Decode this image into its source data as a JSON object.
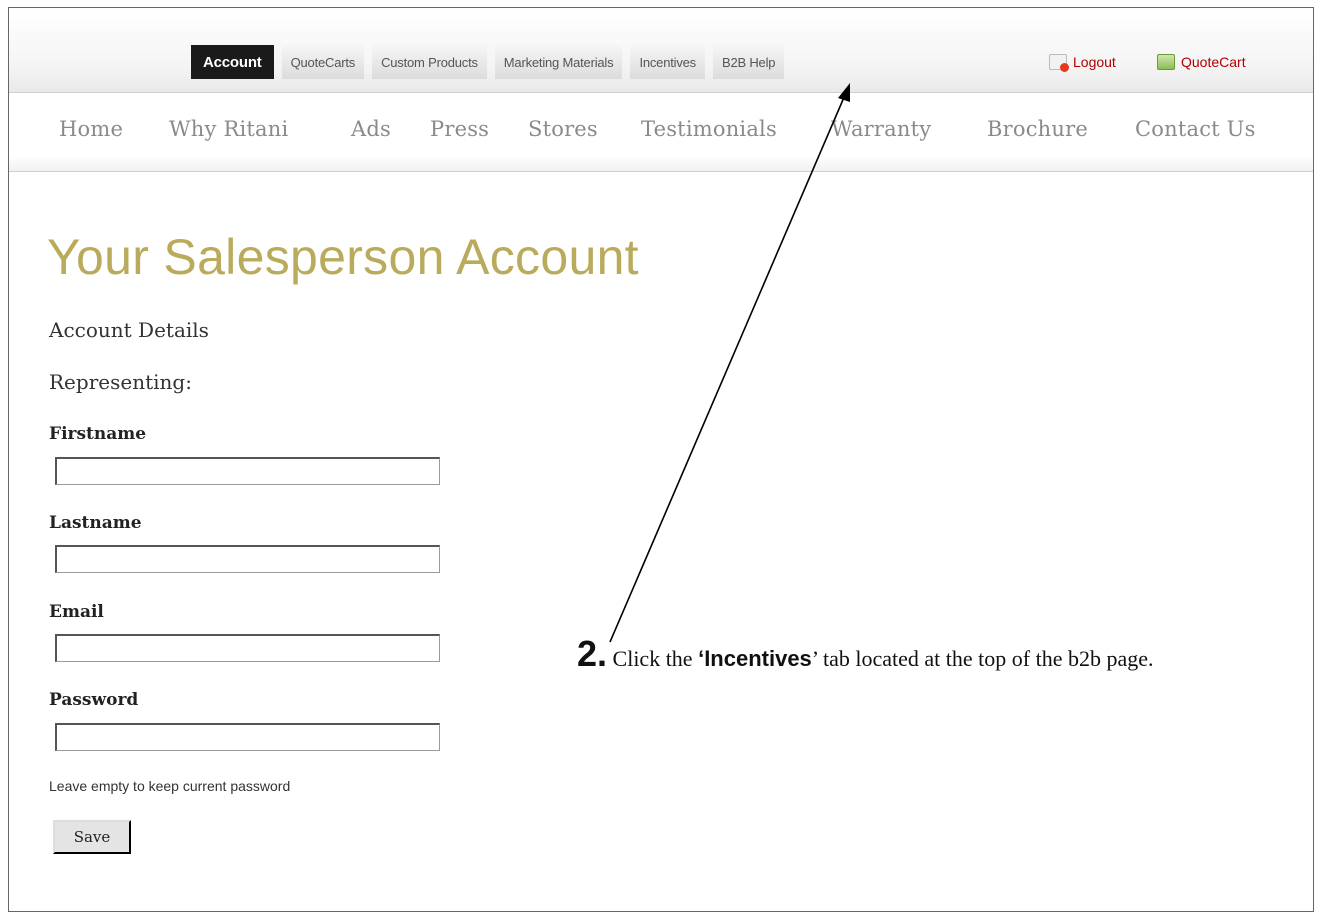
{
  "top_tabs": [
    {
      "label": "Account",
      "active": true
    },
    {
      "label": "QuoteCarts"
    },
    {
      "label": "Custom Products"
    },
    {
      "label": "Marketing Materials"
    },
    {
      "label": "Incentives"
    },
    {
      "label": "B2B Help"
    }
  ],
  "utility": {
    "logout": "Logout",
    "quotecart": "QuoteCart"
  },
  "main_nav": [
    "Home",
    "Why Ritani",
    "Ads",
    "Press",
    "Stores",
    "Testimonials",
    "Warranty",
    "Brochure",
    "Contact Us"
  ],
  "page": {
    "title": "Your Salesperson Account",
    "section": "Account Details",
    "representing": "Representing:"
  },
  "form": {
    "firstname_label": "Firstname",
    "firstname_value": "",
    "lastname_label": "Lastname",
    "lastname_value": "",
    "email_label": "Email",
    "email_value": "",
    "password_label": "Password",
    "password_value": "",
    "password_hint": "Leave empty to keep current password",
    "save_label": "Save"
  },
  "annotation": {
    "step_number": "2.",
    "text_before": "Click the ",
    "highlight": "‘Incentives",
    "text_after": "’ tab located at the top of the b2b page."
  },
  "colors": {
    "title": "#b9ab5b",
    "active_tab_bg": "#1a1a1a",
    "utility_link": "#b00000"
  }
}
